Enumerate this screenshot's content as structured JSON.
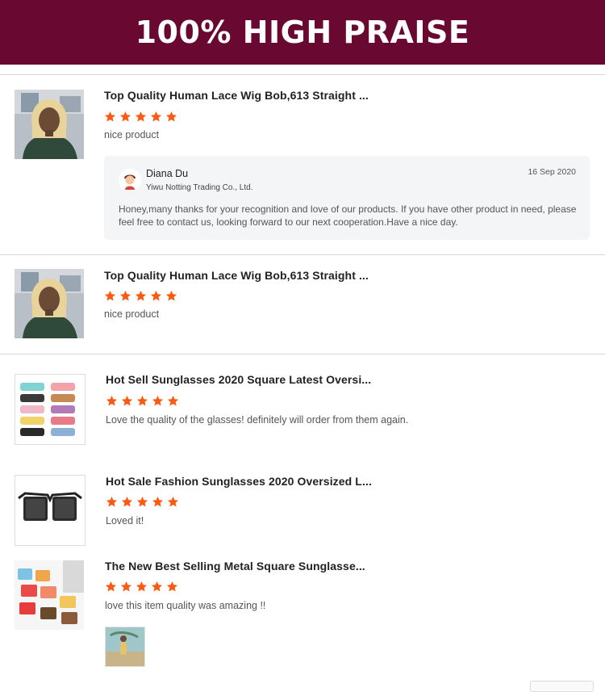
{
  "banner": {
    "title": "100% HIGH PRAISE"
  },
  "reviews": [
    {
      "product_title": "Top Quality Human Lace Wig Bob,613 Straight ...",
      "rating": 5,
      "comment": "nice product",
      "reply": {
        "seller_name": "Diana Du",
        "company": "Yiwu Notting Trading Co., Ltd.",
        "date": "16 Sep 2020",
        "message": "Honey,many thanks for your recognition and love of our products. If you have other product in need, please feel free to contact us, looking forward to our next cooperation.Have a nice day."
      }
    },
    {
      "product_title": "Top Quality Human Lace Wig Bob,613 Straight ...",
      "rating": 5,
      "comment": "nice product"
    },
    {
      "product_title": "Hot Sell Sunglasses 2020 Square Latest Oversi...",
      "rating": 5,
      "comment": "Love the quality of the glasses! definitely will order from them again."
    },
    {
      "product_title": "Hot Sale Fashion Sunglasses 2020 Oversized L...",
      "rating": 5,
      "comment": "Loved it!"
    },
    {
      "product_title": "The New Best Selling Metal Square Sunglasse...",
      "rating": 5,
      "comment": "love this item quality was amazing !!"
    }
  ],
  "colors": {
    "banner": "#690830",
    "star": "#fa5a14"
  },
  "icons": {
    "star": "star-icon",
    "avatar": "seller-avatar-icon"
  }
}
